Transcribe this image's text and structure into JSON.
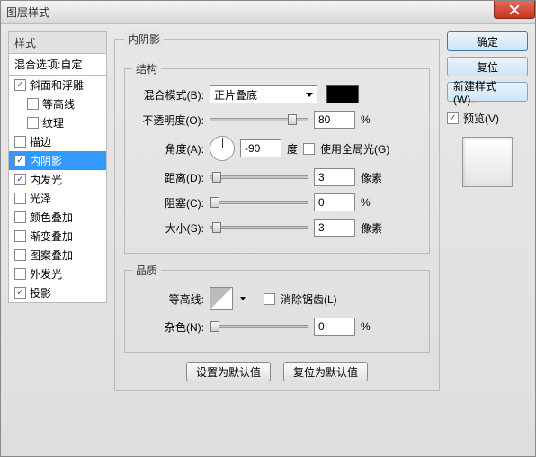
{
  "window_title": "图层样式",
  "left": {
    "header": "样式",
    "blend_options": "混合选项:自定",
    "items": [
      {
        "label": "斜面和浮雕",
        "checked": true,
        "indent": false
      },
      {
        "label": "等高线",
        "checked": false,
        "indent": true
      },
      {
        "label": "纹理",
        "checked": false,
        "indent": true
      },
      {
        "label": "描边",
        "checked": false,
        "indent": false
      },
      {
        "label": "内阴影",
        "checked": true,
        "indent": false,
        "selected": true
      },
      {
        "label": "内发光",
        "checked": true,
        "indent": false
      },
      {
        "label": "光泽",
        "checked": false,
        "indent": false
      },
      {
        "label": "颜色叠加",
        "checked": false,
        "indent": false
      },
      {
        "label": "渐变叠加",
        "checked": false,
        "indent": false
      },
      {
        "label": "图案叠加",
        "checked": false,
        "indent": false
      },
      {
        "label": "外发光",
        "checked": false,
        "indent": false
      },
      {
        "label": "投影",
        "checked": true,
        "indent": false
      }
    ]
  },
  "center": {
    "panel_title": "内阴影",
    "structure_title": "结构",
    "blend_mode_label": "混合模式(B):",
    "blend_mode_value": "正片叠底",
    "color": "#000000",
    "opacity_label": "不透明度(O):",
    "opacity_value": "80",
    "percent": "%",
    "angle_label": "角度(A):",
    "angle_value": "-90",
    "degree": "度",
    "global_light_label": "使用全局光(G)",
    "global_light_checked": false,
    "distance_label": "距离(D):",
    "distance_value": "3",
    "px": "像素",
    "choke_label": "阻塞(C):",
    "choke_value": "0",
    "size_label": "大小(S):",
    "size_value": "3",
    "quality_title": "品质",
    "contour_label": "等高线:",
    "antialias_label": "消除锯齿(L)",
    "antialias_checked": false,
    "noise_label": "杂色(N):",
    "noise_value": "0",
    "make_default": "设置为默认值",
    "reset_default": "复位为默认值"
  },
  "right": {
    "ok": "确定",
    "cancel": "复位",
    "new_style": "新建样式(W)...",
    "preview_label": "预览(V)",
    "preview_checked": true
  }
}
